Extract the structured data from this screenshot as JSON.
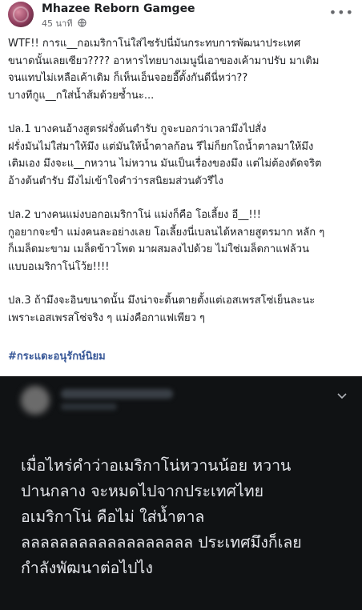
{
  "post": {
    "author": "Mhazee Reborn Gamgee",
    "time": "45 นาที",
    "more_label": "•••",
    "paragraphs": [
      [
        "WTF!! การแ__กอเมริกาโน่ใส่ไซรัปนี่มันกระทบการพัฒนาประเทศ",
        "ขนาดนั้นเลยเซียว???? อาหารไทยบางเมนูนี่เอาของเค้ามาปรับ มาเติม",
        "จนแทบไม่เหลือเค้าเดิม ก็เห็นเอ็นจอยอี๊ตั้งกันดีนี่หว่า??",
        "บางทีกูแ__กใส่น้ำส้มด้วยซ้ำนะ..."
      ],
      [
        "ปล.1 บางคนอ้างสูตรฝรั่งต้นตำรับ กูจะบอกว่าเวลามึงไปสั่ง",
        "ฝรั่งมันไม่ใส่มาให้มึง แต่มันให้น้ำตาลก้อน รึไม่ก็ยกโถน้ำตาลมาให้มึง",
        "เติมเอง มึงจะแ__กหวาน ไม่หวาน มันเป็นเรื่องของมึง แต่ไม่ต้องดัดจริต",
        "อ้างต้นตำรับ มึงไม่เข้าใจคำว่ารสนิยมส่วนตัวรึไง"
      ],
      [
        "ปล.2 บางคนแม่งบอกอเมริกาโน่ แม่งก็คือ โอเลี้ยง อี__!!!",
        "กูอยากจะขำ แม่งคนละอย่างเลย โอเลี้ยงนี่เบลนได้หลายสูตรมาก หลัก ๆ",
        "ก็เมล็ดมะขาม เมล็ดข้าวโพด มาผสมลงไปด้วย ไม่ใช่เมล็ดกาแฟล้วน",
        "แบบอเมริกาโน่โว้ย!!!!"
      ],
      [
        "ปล.3 ถ้ามึงจะอินขนาดนั้น มึงน่าจะดิ้นตายตั้งแต่เอสเพรสโซ่เย็นละนะ",
        "เพราะเอสเพรสโซ่จริง ๆ แม่งคือกาแฟเพียว ๆ"
      ]
    ],
    "hashtag": "#กระแดะอนุรักษ์นิยม"
  },
  "embedded_tweet": {
    "lines": [
      "เมื่อไหร่คำว่าอเมริกาโน่หวานน้อย หวาน",
      "ปานกลาง จะหมดไปจากประเทศไทย",
      "อเมริกาโน่ คือไม่ ใส่น้ำตาล",
      "ลลลลลลลลลลลลลลลลลล ประเทศมึงก็เลย",
      "กำลังพัฒนาต่อไปไง"
    ]
  },
  "colors": {
    "link": "#385898",
    "muted": "#65676b",
    "dark_bg": "#101214",
    "dark_text": "#e4e6eb"
  },
  "icons": [
    "globe-icon",
    "more-icon",
    "chevron-down-icon"
  ]
}
